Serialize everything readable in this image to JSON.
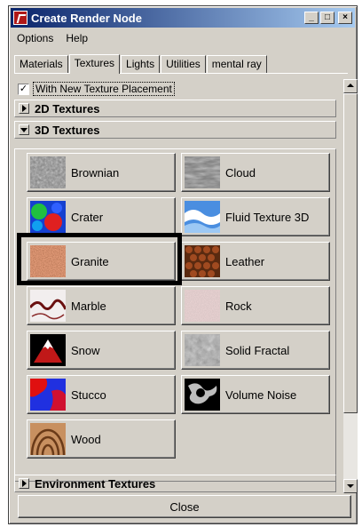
{
  "window": {
    "title": "Create Render Node",
    "minimize_glyph": "_",
    "maximize_glyph": "□",
    "close_glyph": "×"
  },
  "menu": [
    "Options",
    "Help"
  ],
  "tabs": [
    {
      "label": "Materials",
      "active": false
    },
    {
      "label": "Textures",
      "active": true
    },
    {
      "label": "Lights",
      "active": false
    },
    {
      "label": "Utilities",
      "active": false
    },
    {
      "label": "mental ray",
      "active": false
    }
  ],
  "placement": {
    "label": "With New Texture Placement",
    "checked": true,
    "check_glyph": "✓"
  },
  "sections": {
    "textures_2d": "2D Textures",
    "textures_3d": "3D Textures",
    "environment": "Environment Textures"
  },
  "nodes": [
    {
      "label": "Brownian",
      "icon": "brownian-swatch-icon"
    },
    {
      "label": "Cloud",
      "icon": "cloud-swatch-icon"
    },
    {
      "label": "Crater",
      "icon": "crater-swatch-icon"
    },
    {
      "label": "Fluid Texture 3D",
      "icon": "fluid-texture-swatch-icon"
    },
    {
      "label": "Granite",
      "icon": "granite-swatch-icon",
      "highlighted": true
    },
    {
      "label": "Leather",
      "icon": "leather-swatch-icon"
    },
    {
      "label": "Marble",
      "icon": "marble-swatch-icon"
    },
    {
      "label": "Rock",
      "icon": "rock-swatch-icon"
    },
    {
      "label": "Snow",
      "icon": "snow-swatch-icon"
    },
    {
      "label": "Solid Fractal",
      "icon": "solid-fractal-swatch-icon"
    },
    {
      "label": "Stucco",
      "icon": "stucco-swatch-icon"
    },
    {
      "label": "Volume Noise",
      "icon": "volume-noise-swatch-icon"
    },
    {
      "label": "Wood",
      "icon": "wood-swatch-icon"
    }
  ],
  "close_label": "Close",
  "colors": {
    "title_gradient_start": "#0a246a",
    "title_gradient_end": "#a6caf0",
    "face": "#d4d0c8",
    "highlight_box": "#000000"
  }
}
